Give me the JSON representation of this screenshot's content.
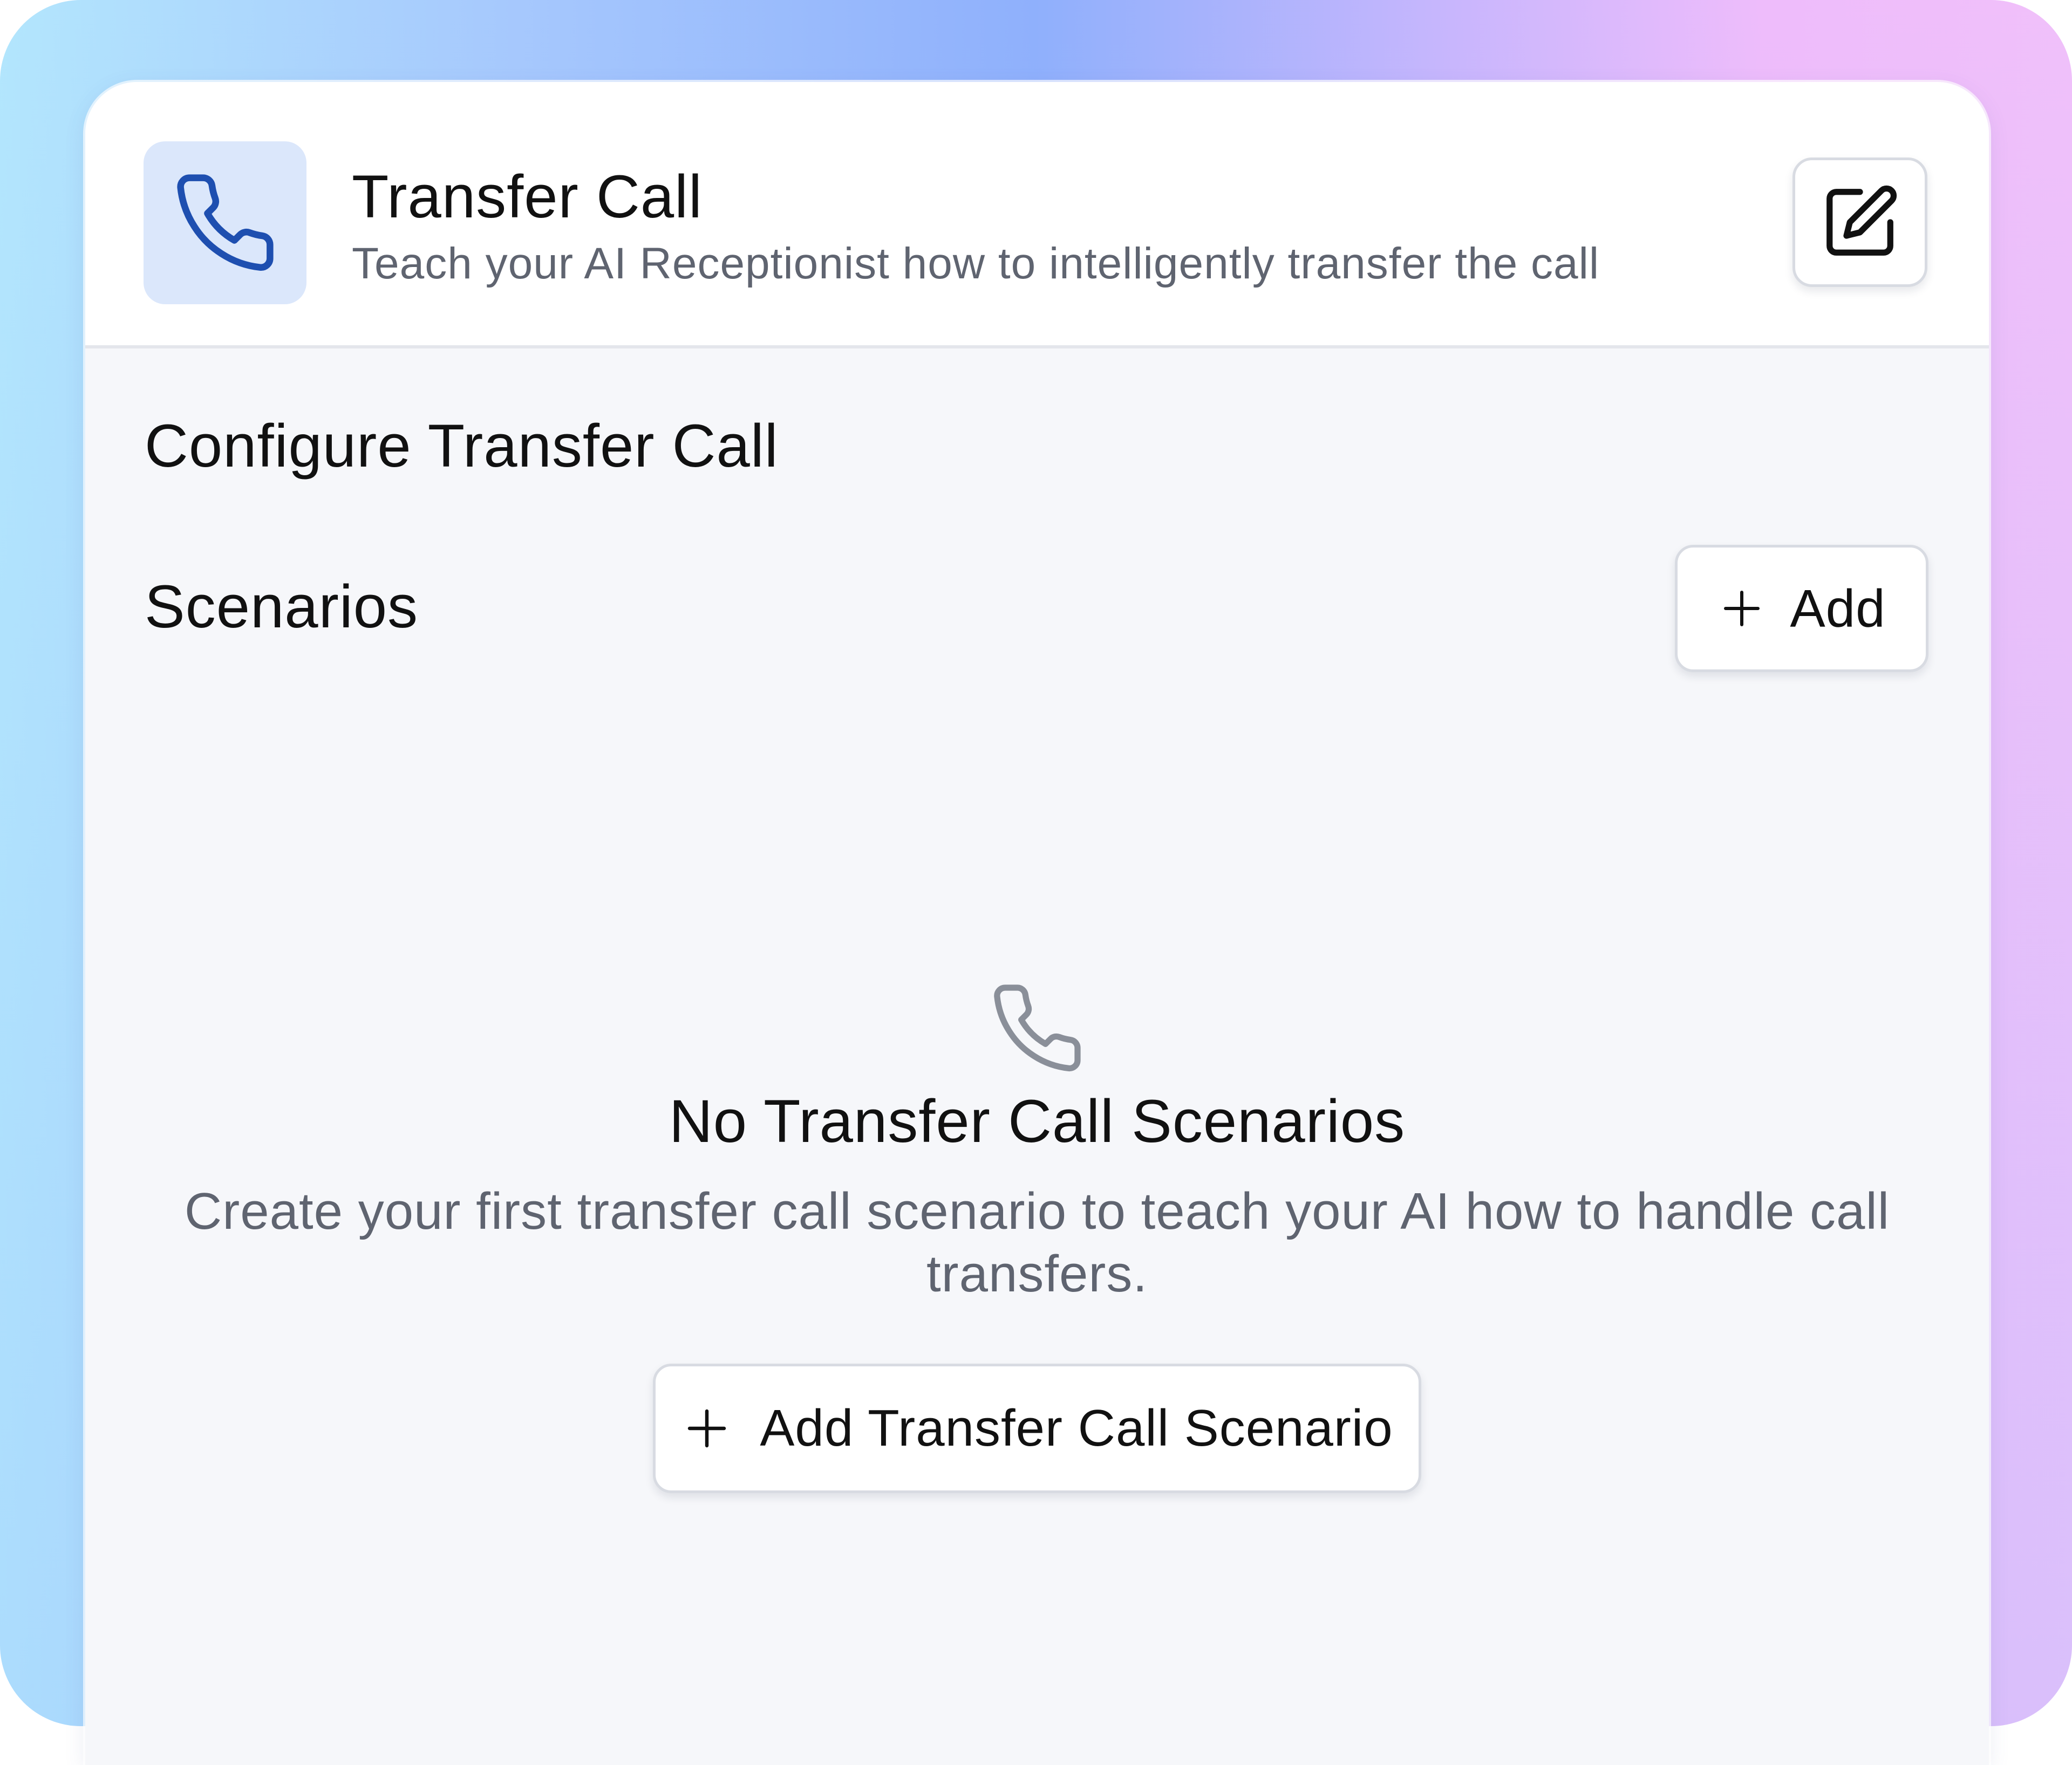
{
  "header": {
    "title": "Transfer Call",
    "subtitle": "Teach your AI Receptionist how to intelligently transfer the call",
    "icon": "phone-icon",
    "edit_icon": "edit-icon"
  },
  "configure": {
    "title": "Configure Transfer Call"
  },
  "scenarios": {
    "label": "Scenarios",
    "add_button_label": "Add",
    "add_icon": "plus-icon"
  },
  "empty_state": {
    "icon": "phone-icon",
    "title": "No Transfer Call Scenarios",
    "description": "Create your first transfer call scenario to teach your AI how to handle call transfers.",
    "button_label": "Add Transfer Call Scenario"
  },
  "colors": {
    "accent": "#1e4fb0",
    "icon_box": "#dbe7fb",
    "muted_text": "#5f6470",
    "card_bg": "#f6f7fa"
  }
}
